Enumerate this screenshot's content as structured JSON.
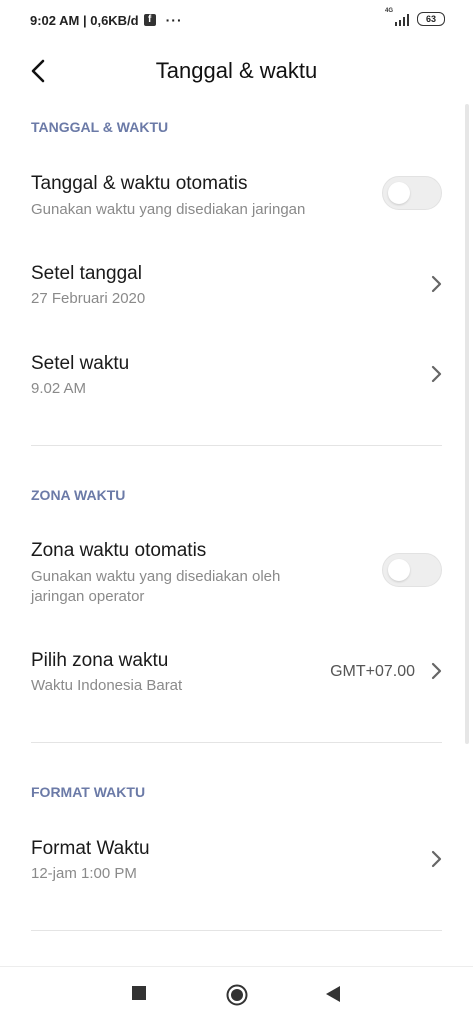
{
  "status_bar": {
    "time_speed": "9:02 AM | 0,6KB/d",
    "fb_letter": "f",
    "more": "···",
    "network": "4G",
    "battery": "63"
  },
  "header": {
    "title": "Tanggal & waktu",
    "back_icon": "chevron-left-icon"
  },
  "sections": {
    "date_time": {
      "label": "TANGGAL & WAKTU",
      "auto": {
        "title": "Tanggal & waktu otomatis",
        "subtitle": "Gunakan waktu yang disediakan jaringan",
        "enabled": false
      },
      "set_date": {
        "title": "Setel tanggal",
        "subtitle": "27 Februari 2020"
      },
      "set_time": {
        "title": "Setel waktu",
        "subtitle": "9.02 AM"
      }
    },
    "time_zone": {
      "label": "ZONA WAKTU",
      "auto": {
        "title": "Zona waktu otomatis",
        "subtitle_line1": "Gunakan waktu yang disediakan oleh",
        "subtitle_line2": "jaringan operator",
        "enabled": false
      },
      "pick": {
        "title": "Pilih zona waktu",
        "subtitle": "Waktu Indonesia Barat",
        "value": "GMT+07.00"
      }
    },
    "time_format": {
      "label": "FORMAT WAKTU",
      "format": {
        "title": "Format Waktu",
        "subtitle": "12-jam 1:00 PM"
      }
    }
  },
  "nav_bar": {
    "recents_icon": "square-icon",
    "home_icon": "circle-icon",
    "back_icon": "triangle-back-icon"
  },
  "colors": {
    "section_label": "#6b7aa7",
    "toggle_off": "#eeeeee"
  }
}
